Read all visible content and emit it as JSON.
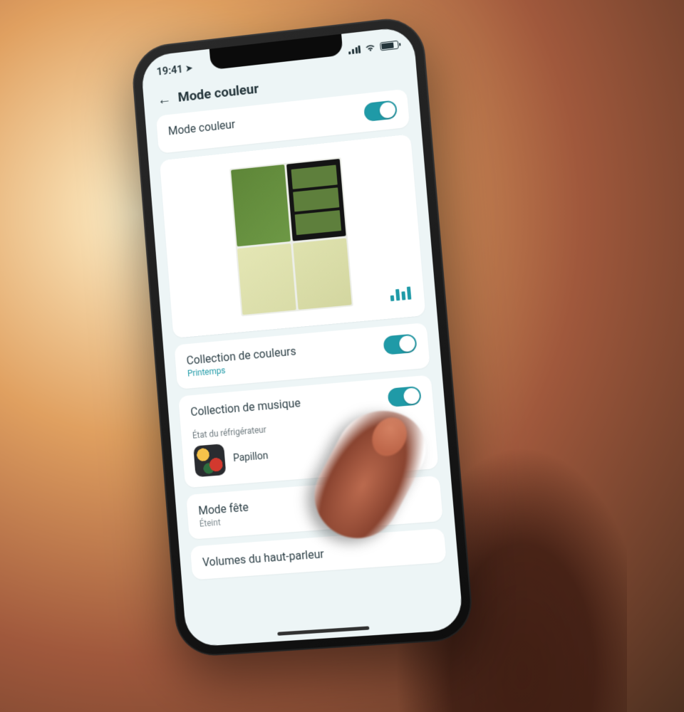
{
  "status": {
    "time": "19:41"
  },
  "header": {
    "title": "Mode couleur"
  },
  "cards": {
    "mode": {
      "title": "Mode couleur",
      "toggle_on": true
    },
    "colors": {
      "title": "Collection de couleurs",
      "subtitle": "Printemps",
      "toggle_on": true
    },
    "music": {
      "title": "Collection de musique",
      "toggle_on": true,
      "section_label": "État du réfrigérateur",
      "track_name": "Papillon"
    },
    "party": {
      "title": "Mode fête",
      "subtitle": "Éteint"
    },
    "speaker": {
      "title": "Volumes du haut-parleur"
    }
  },
  "colors": {
    "accent": "#1f9aa7",
    "fridge_top_left": "#6d9845",
    "fridge_top_right": "#141414",
    "fridge_bottom": "#dfe2ae"
  }
}
